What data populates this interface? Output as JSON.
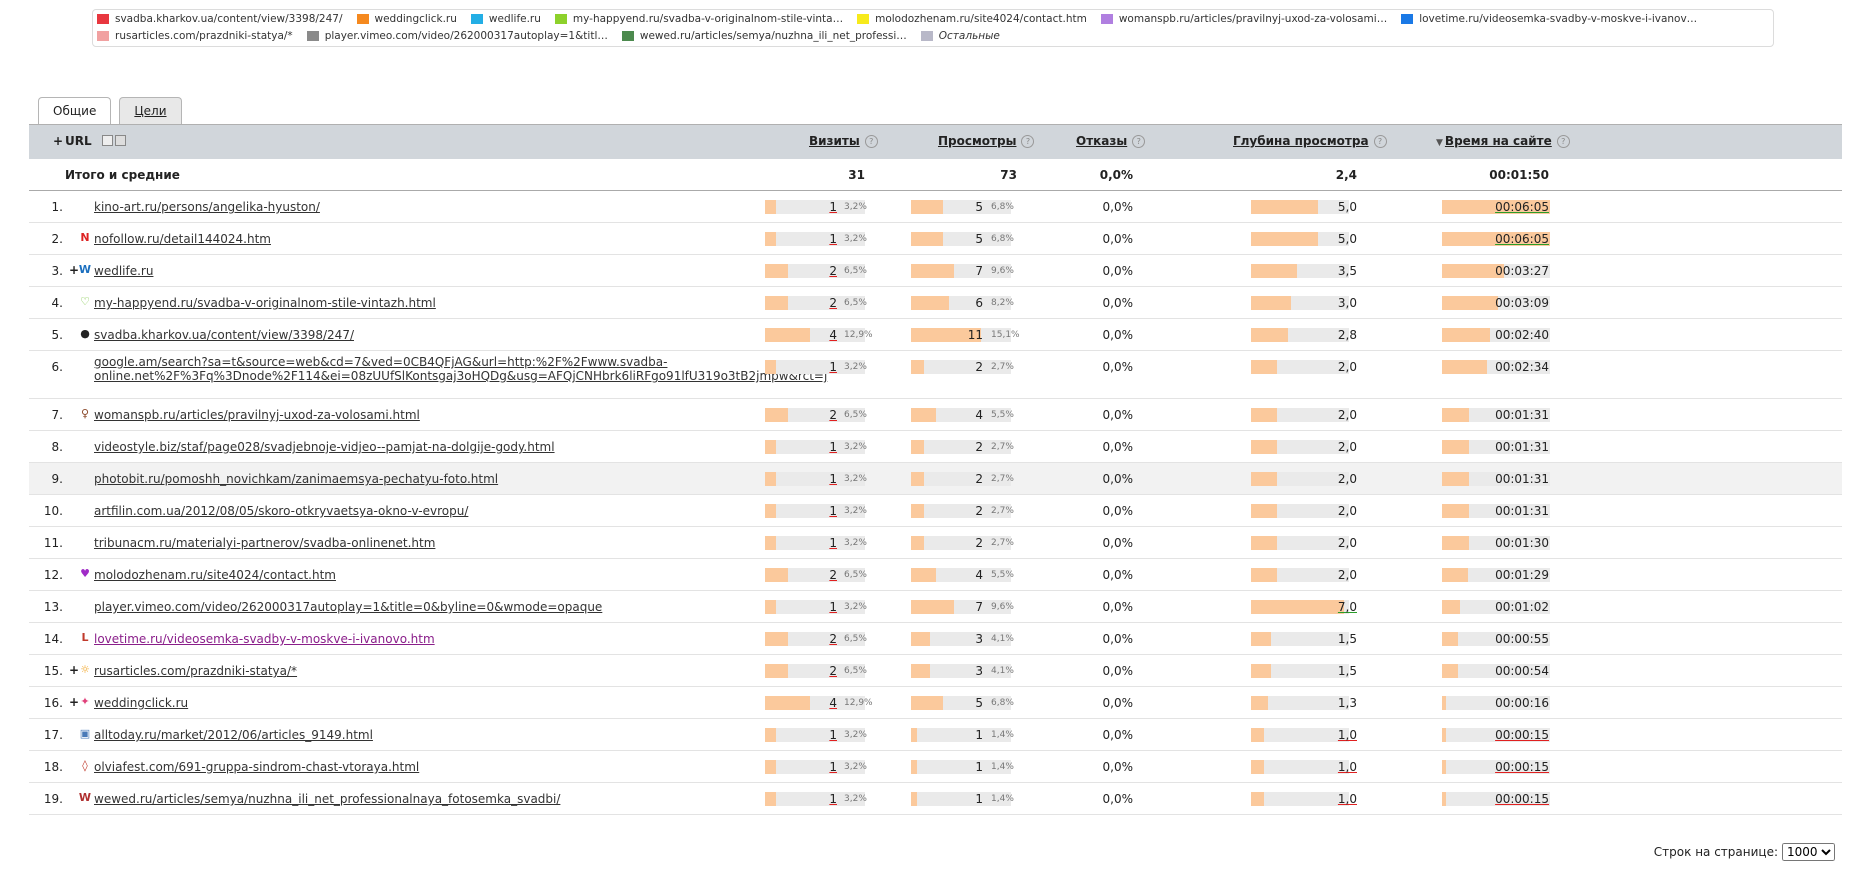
{
  "legend": [
    {
      "label": "svadba.kharkov.ua/content/view/3398/247/",
      "color": "#e8373f",
      "icon": "red-swatch"
    },
    {
      "label": "weddingclick.ru",
      "color": "#f5891f",
      "icon": "orange-swatch"
    },
    {
      "label": "wedlife.ru",
      "color": "#23aee5",
      "icon": "cyan-swatch"
    },
    {
      "label": "my-happyend.ru/svadba-v-originalnom-stile-vinta…",
      "color": "#8dd12b",
      "icon": "green-swatch"
    },
    {
      "label": "molodozhenam.ru/site4024/contact.htm",
      "color": "#f7ea1b",
      "icon": "yellow-swatch"
    },
    {
      "label": "womanspb.ru/articles/pravilnyj-uxod-za-volosami…",
      "color": "#b07fe0",
      "icon": "violet-swatch"
    },
    {
      "label": "lovetime.ru/videosemka-svadby-v-moskve-i-ivanov…",
      "color": "#1a79e6",
      "icon": "blue-swatch"
    },
    {
      "label": "rusarticles.com/prazdniki-statya/*",
      "color": "#f1a1a1",
      "icon": "pink-swatch"
    },
    {
      "label": "player.vimeo.com/video/262000317autoplay=1&titl…",
      "color": "#8a8a8a",
      "icon": "gray-swatch"
    },
    {
      "label": "wewed.ru/articles/semya/nuzhna_ili_net_professi…",
      "color": "#4c8a4e",
      "icon": "dark-green-swatch"
    },
    {
      "label": "Остальные",
      "color": "#b8b8c8",
      "icon": "light-gray-swatch"
    }
  ],
  "tabs": [
    {
      "label": "Общие",
      "active": true
    },
    {
      "label": "Цели",
      "active": false
    }
  ],
  "header": {
    "url": "URL",
    "visits": "Визиты",
    "views": "Просмотры",
    "bounces": "Отказы",
    "depth": "Глубина просмотра",
    "time": "Время на сайте",
    "sort_marker": "▼",
    "help": "?",
    "expand": "+"
  },
  "totals": {
    "label": "Итого и средние",
    "visits": "31",
    "views": "73",
    "bounces": "0,0%",
    "depth": "2,4",
    "time": "00:01:50"
  },
  "rows": [
    {
      "n": "1.",
      "plus": "",
      "icon": "none-icon",
      "icon_glyph": "",
      "icon_color": "",
      "url": "kino-art.ru/persons/angelika-hyuston/",
      "visits": "1",
      "visits_pct": "3,2%",
      "views": "5",
      "views_pct": "6,8%",
      "bounces": "0,0%",
      "depth": "5,0",
      "time": "00:06:05",
      "visits_frac": 0.225,
      "views_frac": 0.45,
      "depth_frac": 0.68,
      "time_frac": 1.0
    },
    {
      "n": "2.",
      "plus": "",
      "icon": "nofollow-icon",
      "icon_glyph": "N",
      "icon_color": "#d22",
      "url": "nofollow.ru/detail144024.htm",
      "visits": "1",
      "visits_pct": "3,2%",
      "views": "5",
      "views_pct": "6,8%",
      "bounces": "0,0%",
      "depth": "5,0",
      "time": "00:06:05",
      "visits_frac": 0.225,
      "views_frac": 0.45,
      "depth_frac": 0.68,
      "time_frac": 1.0
    },
    {
      "n": "3.",
      "plus": "+",
      "icon": "wedlife-icon",
      "icon_glyph": "W",
      "icon_color": "#1b6fbf",
      "url": "wedlife.ru",
      "visits": "2",
      "visits_pct": "6,5%",
      "views": "7",
      "views_pct": "9,6%",
      "bounces": "0,0%",
      "depth": "3,5",
      "time": "00:03:27",
      "visits_frac": 0.45,
      "views_frac": 0.62,
      "depth_frac": 0.47,
      "time_frac": 0.57
    },
    {
      "n": "4.",
      "plus": "",
      "icon": "heart-icon",
      "icon_glyph": "♡",
      "icon_color": "#6bbf2a",
      "url": "my-happyend.ru/svadba-v-originalnom-stile-vintazh.html",
      "visits": "2",
      "visits_pct": "6,5%",
      "views": "6",
      "views_pct": "8,2%",
      "bounces": "0,0%",
      "depth": "3,0",
      "time": "00:03:09",
      "visits_frac": 0.45,
      "views_frac": 0.54,
      "depth_frac": 0.41,
      "time_frac": 0.52
    },
    {
      "n": "5.",
      "plus": "",
      "icon": "spy-icon",
      "icon_glyph": "●",
      "icon_color": "#222",
      "url": "svadba.kharkov.ua/content/view/3398/247/",
      "visits": "4",
      "visits_pct": "12,9%",
      "views": "11",
      "views_pct": "15,1%",
      "bounces": "0,0%",
      "depth": "2,8",
      "time": "00:02:40",
      "visits_frac": 0.9,
      "views_frac": 1.0,
      "depth_frac": 0.38,
      "time_frac": 0.44
    },
    {
      "n": "6.",
      "plus": "",
      "icon": "none-icon",
      "icon_glyph": "",
      "icon_color": "",
      "url": "google.am/search?sa=t&source=web&cd=7&ved=0CB4QFjAG&url=http:%2F%2Fwww.svadba-online.net%2F%3Fq%3Dnode%2F114&ei=08zUUfSlKontsgaj3oHQDg&usg=AFQjCNHbrk6liRFgo91lfU319o3tB2jmpw&rct=j",
      "visits": "1",
      "visits_pct": "3,2%",
      "views": "2",
      "views_pct": "2,7%",
      "bounces": "0,0%",
      "depth": "2,0",
      "time": "00:02:34",
      "visits_frac": 0.225,
      "views_frac": 0.18,
      "depth_frac": 0.27,
      "time_frac": 0.42,
      "tall": true
    },
    {
      "n": "7.",
      "plus": "",
      "icon": "woman-icon",
      "icon_glyph": "♀",
      "icon_color": "#8b4a2b",
      "url": "womanspb.ru/articles/pravilnyj-uxod-za-volosami.html",
      "visits": "2",
      "visits_pct": "6,5%",
      "views": "4",
      "views_pct": "5,5%",
      "bounces": "0,0%",
      "depth": "2,0",
      "time": "00:01:31",
      "visits_frac": 0.45,
      "views_frac": 0.36,
      "depth_frac": 0.27,
      "time_frac": 0.25
    },
    {
      "n": "8.",
      "plus": "",
      "icon": "none-icon",
      "icon_glyph": "",
      "icon_color": "",
      "url": "videostyle.biz/staf/page028/svadjebnoje-vidjeo--pamjat-na-dolgije-gody.html",
      "visits": "1",
      "visits_pct": "3,2%",
      "views": "2",
      "views_pct": "2,7%",
      "bounces": "0,0%",
      "depth": "2,0",
      "time": "00:01:31",
      "visits_frac": 0.225,
      "views_frac": 0.18,
      "depth_frac": 0.27,
      "time_frac": 0.25
    },
    {
      "n": "9.",
      "plus": "",
      "icon": "none-icon",
      "icon_glyph": "",
      "icon_color": "",
      "url": "photobit.ru/pomoshh_novichkam/zanimaemsya-pechatyu-foto.html",
      "visits": "1",
      "visits_pct": "3,2%",
      "views": "2",
      "views_pct": "2,7%",
      "bounces": "0,0%",
      "depth": "2,0",
      "time": "00:01:31",
      "visits_frac": 0.225,
      "views_frac": 0.18,
      "depth_frac": 0.27,
      "time_frac": 0.25,
      "hl": true
    },
    {
      "n": "10.",
      "plus": "",
      "icon": "none-icon",
      "icon_glyph": "",
      "icon_color": "",
      "url": "artfilin.com.ua/2012/08/05/skoro-otkryvaetsya-okno-v-evropu/",
      "visits": "1",
      "visits_pct": "3,2%",
      "views": "2",
      "views_pct": "2,7%",
      "bounces": "0,0%",
      "depth": "2,0",
      "time": "00:01:31",
      "visits_frac": 0.225,
      "views_frac": 0.18,
      "depth_frac": 0.27,
      "time_frac": 0.25
    },
    {
      "n": "11.",
      "plus": "",
      "icon": "none-icon",
      "icon_glyph": "",
      "icon_color": "",
      "url": "tribunacm.ru/materialyi-partnerov/svadba-onlinenet.htm",
      "visits": "1",
      "visits_pct": "3,2%",
      "views": "2",
      "views_pct": "2,7%",
      "bounces": "0,0%",
      "depth": "2,0",
      "time": "00:01:30",
      "visits_frac": 0.225,
      "views_frac": 0.18,
      "depth_frac": 0.27,
      "time_frac": 0.25
    },
    {
      "n": "12.",
      "plus": "",
      "icon": "molodozhenam-icon",
      "icon_glyph": "♥",
      "icon_color": "#a02bc7",
      "url": "molodozhenam.ru/site4024/contact.htm",
      "visits": "2",
      "visits_pct": "6,5%",
      "views": "4",
      "views_pct": "5,5%",
      "bounces": "0,0%",
      "depth": "2,0",
      "time": "00:01:29",
      "visits_frac": 0.45,
      "views_frac": 0.36,
      "depth_frac": 0.27,
      "time_frac": 0.24
    },
    {
      "n": "13.",
      "plus": "",
      "icon": "none-icon",
      "icon_glyph": "",
      "icon_color": "",
      "url": "player.vimeo.com/video/262000317autoplay=1&title=0&byline=0&wmode=opaque",
      "visits": "1",
      "visits_pct": "3,2%",
      "views": "7",
      "views_pct": "9,6%",
      "bounces": "0,0%",
      "depth": "7,0",
      "time": "00:01:02",
      "visits_frac": 0.225,
      "views_frac": 0.62,
      "depth_frac": 0.95,
      "time_frac": 0.17
    },
    {
      "n": "14.",
      "plus": "",
      "icon": "lovetime-icon",
      "icon_glyph": "L",
      "icon_color": "#c0392b",
      "url": "lovetime.ru/videosemka-svadby-v-moskve-i-ivanovo.htm",
      "visits": "2",
      "visits_pct": "6,5%",
      "views": "3",
      "views_pct": "4,1%",
      "bounces": "0,0%",
      "depth": "1,5",
      "time": "00:00:55",
      "visits_frac": 0.45,
      "views_frac": 0.27,
      "depth_frac": 0.2,
      "time_frac": 0.15,
      "visited": true
    },
    {
      "n": "15.",
      "plus": "+",
      "icon": "sun-icon",
      "icon_glyph": "☼",
      "icon_color": "#f0a01a",
      "url": "rusarticles.com/prazdniki-statya/*",
      "visits": "2",
      "visits_pct": "6,5%",
      "views": "3",
      "views_pct": "4,1%",
      "bounces": "0,0%",
      "depth": "1,5",
      "time": "00:00:54",
      "visits_frac": 0.45,
      "views_frac": 0.27,
      "depth_frac": 0.2,
      "time_frac": 0.15
    },
    {
      "n": "16.",
      "plus": "+",
      "icon": "weddingclick-icon",
      "icon_glyph": "✦",
      "icon_color": "#e0407a",
      "url": "weddingclick.ru",
      "visits": "4",
      "visits_pct": "12,9%",
      "views": "5",
      "views_pct": "6,8%",
      "bounces": "0,0%",
      "depth": "1,3",
      "time": "00:00:16",
      "visits_frac": 0.9,
      "views_frac": 0.45,
      "depth_frac": 0.17,
      "time_frac": 0.04
    },
    {
      "n": "17.",
      "plus": "",
      "icon": "alltoday-icon",
      "icon_glyph": "▣",
      "icon_color": "#4a7ab8",
      "url": "alltoday.ru/market/2012/06/articles_9149.html",
      "visits": "1",
      "visits_pct": "3,2%",
      "views": "1",
      "views_pct": "1,4%",
      "bounces": "0,0%",
      "depth": "1,0",
      "time": "00:00:15",
      "visits_frac": 0.225,
      "views_frac": 0.09,
      "depth_frac": 0.135,
      "time_frac": 0.04
    },
    {
      "n": "18.",
      "plus": "",
      "icon": "olviafest-icon",
      "icon_glyph": "◊",
      "icon_color": "#c0392b",
      "url": "olviafest.com/691-gruppa-sindrom-chast-vtoraya.html",
      "visits": "1",
      "visits_pct": "3,2%",
      "views": "1",
      "views_pct": "1,4%",
      "bounces": "0,0%",
      "depth": "1,0",
      "time": "00:00:15",
      "visits_frac": 0.225,
      "views_frac": 0.09,
      "depth_frac": 0.135,
      "time_frac": 0.04
    },
    {
      "n": "19.",
      "plus": "",
      "icon": "wewed-icon",
      "icon_glyph": "W",
      "icon_color": "#b03030",
      "url": "wewed.ru/articles/semya/nuzhna_ili_net_professionalnaya_fotosemka_svadbi/",
      "visits": "1",
      "visits_pct": "3,2%",
      "views": "1",
      "views_pct": "1,4%",
      "bounces": "0,0%",
      "depth": "1,0",
      "time": "00:00:15",
      "visits_frac": 0.225,
      "views_frac": 0.09,
      "depth_frac": 0.135,
      "time_frac": 0.04
    }
  ],
  "pager": {
    "label": "Строк на странице:",
    "value": "1000"
  }
}
